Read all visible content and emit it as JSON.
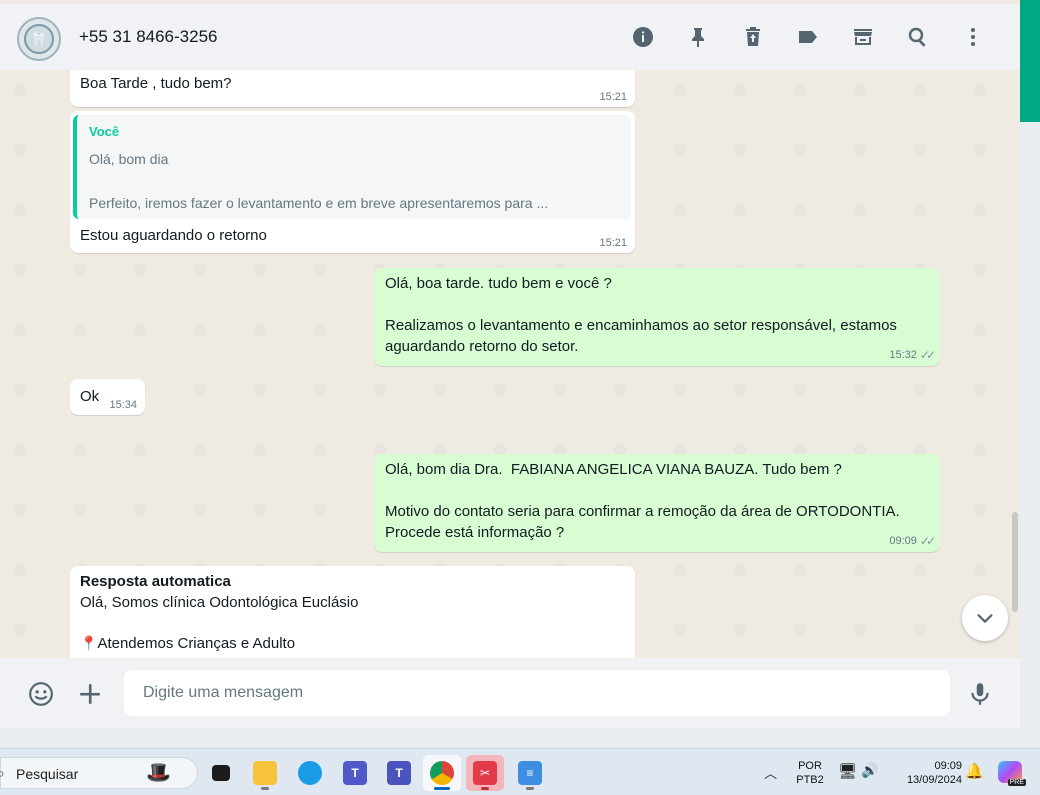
{
  "header": {
    "contact_name": "+55 31 8466-3256",
    "icons": [
      "info-icon",
      "pin-icon",
      "delete-icon",
      "label-icon",
      "catalog-icon",
      "search-icon",
      "menu-icon"
    ]
  },
  "messages": {
    "m1": {
      "text": "Boa Tarde , tudo bem?",
      "time": "15:21"
    },
    "m2": {
      "quote_author": "Você",
      "quote_text": "Olá, bom dia\n\nPerfeito, iremos fazer o levantamento e em breve apresentaremos para ...",
      "text": "Estou aguardando o retorno",
      "time": "15:21"
    },
    "m3": {
      "text": "Olá, boa tarde. tudo bem e você ?\n\nRealizamos o levantamento e encaminhamos ao setor responsável, estamos\naguardando retorno do setor.",
      "time": "15:32"
    },
    "m4": {
      "text": "Ok",
      "time": "15:34"
    },
    "m5": {
      "text": "Olá, bom dia Dra.  FABIANA ANGELICA VIANA BAUZA. Tudo bem ?\n\nMotivo do contato seria para confirmar a remoção da área de ORTODONTIA.\nProcede está informação ?",
      "time": "09:09"
    },
    "m6": {
      "title": "Resposta automatica",
      "line1": "Olá, Somos clínica Odontológica Euclásio",
      "line2": "Atendemos Crianças e Adulto"
    }
  },
  "footer": {
    "placeholder": "Digite uma mensagem"
  },
  "taskbar": {
    "search_label": "Pesquisar",
    "lang_top": "POR",
    "lang_bottom": "PTB2",
    "clock_time": "09:09",
    "clock_date": "13/09/2024",
    "copilot_badge": "PRE"
  },
  "colors": {
    "accent": "#00a884",
    "outgoing": "#d9fdd3",
    "incoming": "#ffffff",
    "chat_bg": "#efeae2"
  }
}
